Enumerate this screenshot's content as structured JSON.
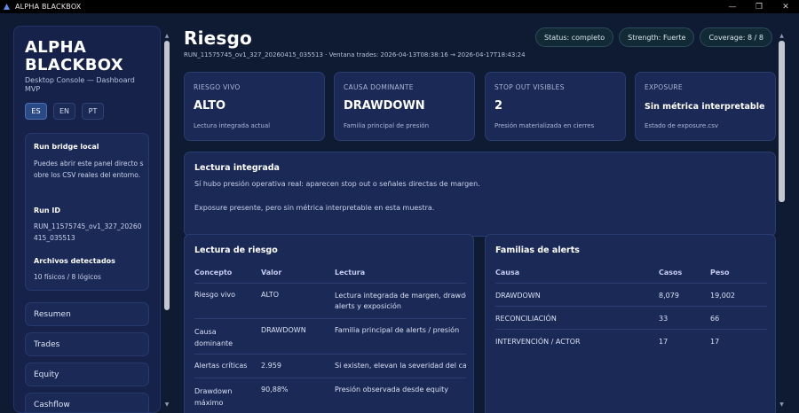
{
  "window": {
    "title": "ALPHA BLACKBOX"
  },
  "sidebar": {
    "brand": "ALPHA BLACKBOX",
    "subtitle": "Desktop Console — Dashboard MVP",
    "languages": [
      "ES",
      "EN",
      "PT"
    ],
    "active_language": "ES",
    "bridge_title": "Run bridge local",
    "bridge_text": "Puedes abrir este panel directo sobre los CSV reales del entorno.",
    "run_id_title": "Run ID",
    "run_id_value": "RUN_11575745_ov1_327_20260415_035513",
    "files_title": "Archivos detectados",
    "files_value": "10 físicos / 8 lógicos",
    "nav": [
      "Resumen",
      "Trades",
      "Equity",
      "Cashflow"
    ]
  },
  "header": {
    "title": "Riesgo",
    "run_line": "RUN_11575745_ov1_327_20260415_035513 · Ventana trades: 2026-04-13T08:38:16 → 2026-04-17T18:43:24",
    "badges": [
      "Status: completo",
      "Strength: Fuerte",
      "Coverage: 8 / 8"
    ]
  },
  "kpis": [
    {
      "label": "RIESGO VIVO",
      "value": "ALTO",
      "foot": "Lectura integrada actual"
    },
    {
      "label": "CAUSA DOMINANTE",
      "value": "DRAWDOWN",
      "foot": "Familia principal de presión"
    },
    {
      "label": "STOP OUT VISIBLES",
      "value": "2",
      "foot": "Presión materializada en cierres"
    },
    {
      "label": "EXPOSURE",
      "value": "Sin métrica interpretable",
      "foot": "Estado de exposure.csv"
    }
  ],
  "lectura": {
    "title": "Lectura integrada",
    "line1": "Sí hubo presión operativa real: aparecen stop out o señales directas de margen.",
    "line2": "Exposure presente, pero sin métrica interpretable en esta muestra."
  },
  "risk_table": {
    "title": "Lectura de riesgo",
    "headers": [
      "Concepto",
      "Valor",
      "Lectura"
    ],
    "rows": [
      {
        "concepto": [
          "Riesgo vivo"
        ],
        "valor": "ALTO",
        "lectura": [
          "Lectura integrada de margen, drawdown,",
          "alerts y exposición"
        ]
      },
      {
        "concepto": [
          "Causa",
          "dominante"
        ],
        "valor": "DRAWDOWN",
        "lectura": [
          "Familia principal de alerts / presión"
        ]
      },
      {
        "concepto": [
          "Alertas críticas"
        ],
        "valor": "2.959",
        "lectura": [
          "Si existen, elevan la severidad del caso"
        ]
      },
      {
        "concepto": [
          "Drawdown",
          "máximo"
        ],
        "valor": "90,88%",
        "lectura": [
          "Presión observada desde equity"
        ]
      }
    ]
  },
  "alerts_table": {
    "title": "Familias de alerts",
    "headers": [
      "Causa",
      "Casos",
      "Peso"
    ],
    "rows": [
      {
        "causa": "DRAWDOWN",
        "casos": "8,079",
        "peso": "19,002"
      },
      {
        "causa": "RECONCILIACIÓN",
        "casos": "33",
        "peso": "66"
      },
      {
        "causa": "INTERVENCIÓN / ACTOR",
        "casos": "17",
        "peso": "17"
      }
    ]
  },
  "colors": {
    "background": "#0f1a33",
    "card": "#1b2957",
    "accent": "#2a4a86",
    "badge_border": "#2c4b58"
  }
}
